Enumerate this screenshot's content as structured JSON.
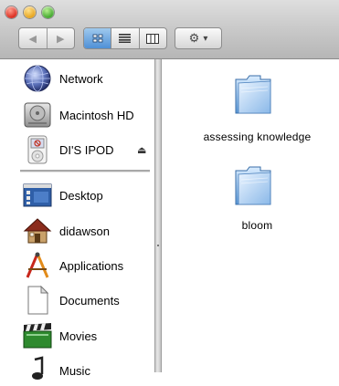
{
  "toolbar": {
    "back_glyph": "◀",
    "forward_glyph": "▶",
    "action_menu_glyph": "⚙",
    "action_caret": "▾"
  },
  "sidebar": {
    "devices": [
      {
        "label": "Network",
        "icon": "network-globe-icon"
      },
      {
        "label": "Macintosh HD",
        "icon": "hard-drive-icon"
      },
      {
        "label": "DI'S IPOD",
        "icon": "ipod-icon",
        "eject": "⏏"
      }
    ],
    "places": [
      {
        "label": "Desktop",
        "icon": "desktop-icon"
      },
      {
        "label": "didawson",
        "icon": "home-icon"
      },
      {
        "label": "Applications",
        "icon": "applications-icon"
      },
      {
        "label": "Documents",
        "icon": "documents-icon"
      },
      {
        "label": "Movies",
        "icon": "movies-icon"
      },
      {
        "label": "Music",
        "icon": "music-icon"
      }
    ]
  },
  "content": {
    "items": [
      {
        "label": "assessing knowledge",
        "icon": "folder-icon"
      },
      {
        "label": "bloom",
        "icon": "folder-icon"
      }
    ]
  },
  "colors": {
    "folder_light": "#cfe5fb",
    "folder_dark": "#5d9ad8",
    "selected_view": "#4f90d6"
  }
}
